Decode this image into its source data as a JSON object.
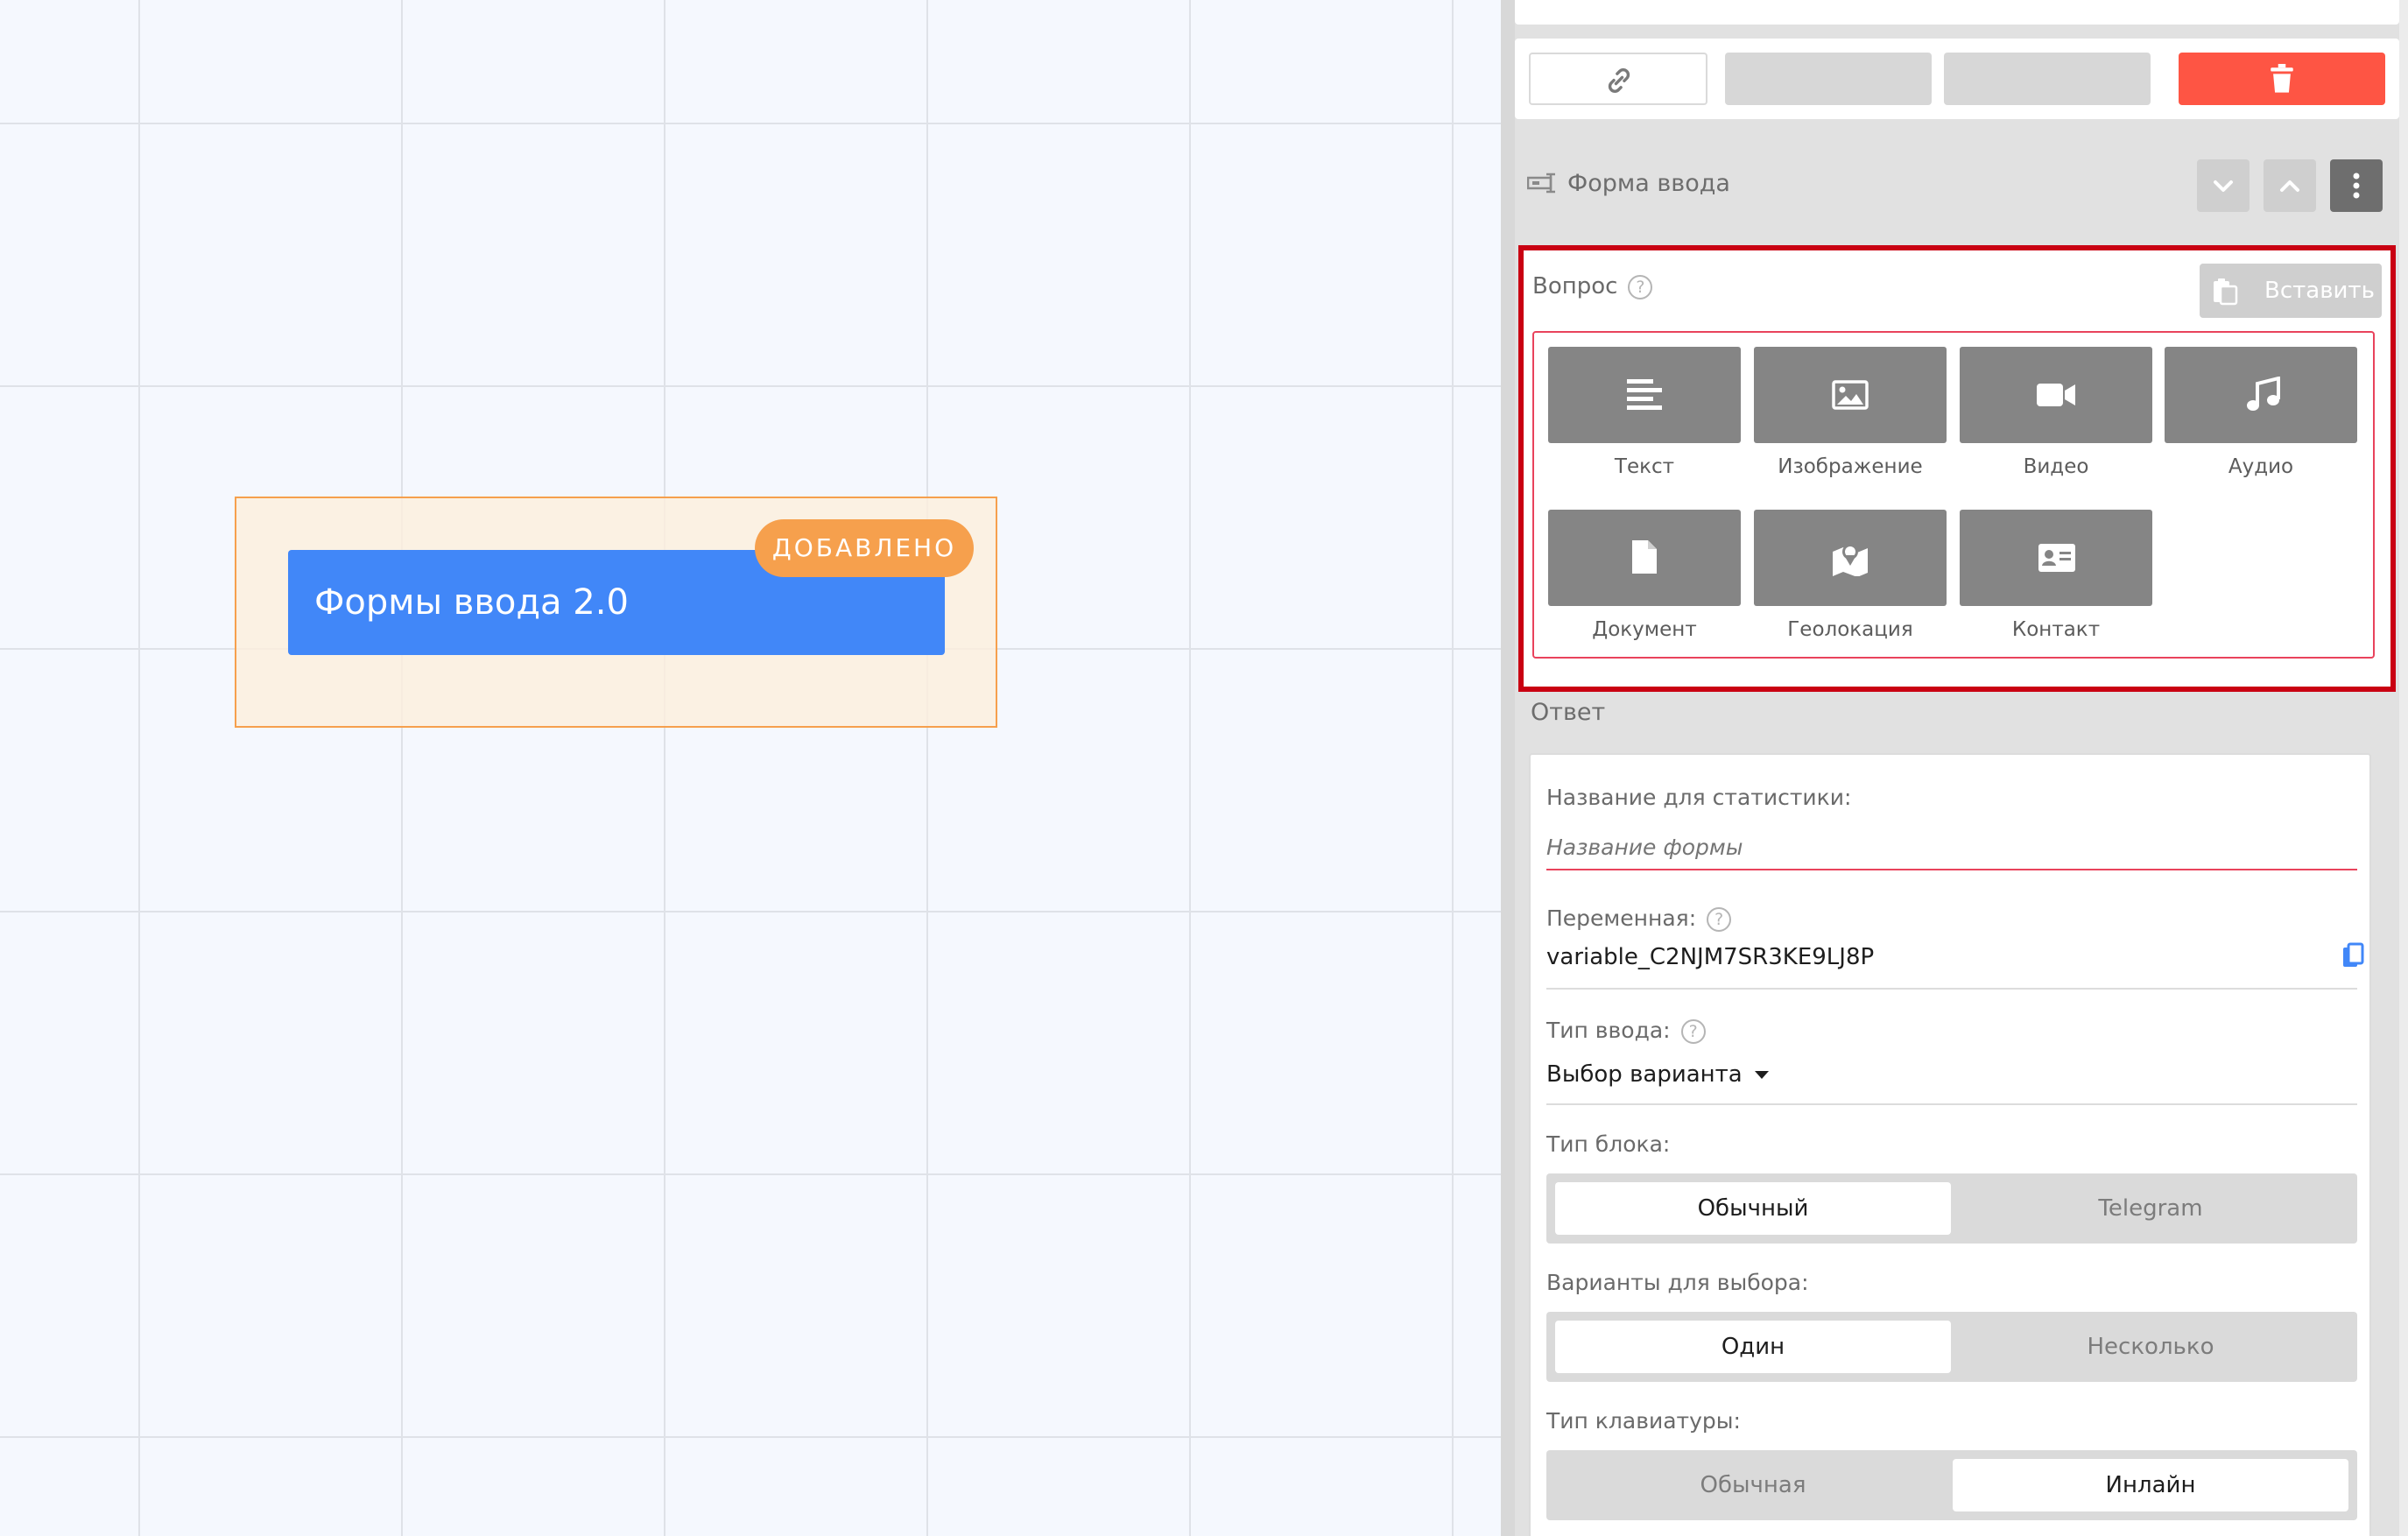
{
  "canvas": {
    "node_title": "Формы ввода 2.0",
    "node_badge": "ДОБАВЛЕНО"
  },
  "panel": {
    "block_type_title": "Форма ввода",
    "question": {
      "label": "Вопрос",
      "paste_label": "Вставить",
      "media": [
        "Текст",
        "Изображение",
        "Видео",
        "Аудио",
        "Документ",
        "Геолокация",
        "Контакт"
      ]
    },
    "answer": {
      "label": "Ответ",
      "stat_name_label": "Название для статистики:",
      "stat_name_placeholder": "Название формы",
      "variable_label": "Переменная:",
      "variable_value": "variable_C2NJM7SR3KE9LJ8P",
      "input_type_label": "Тип ввода:",
      "input_type_value": "Выбор варианта",
      "block_type_label": "Тип блока:",
      "block_type_options": [
        "Обычный",
        "Telegram"
      ],
      "choice_label": "Варианты для выбора:",
      "choice_options": [
        "Один",
        "Несколько"
      ],
      "keyboard_label": "Тип клавиатуры:",
      "keyboard_options": [
        "Обычная",
        "Инлайн"
      ]
    }
  },
  "colors": {
    "accent_blue": "#4187f8",
    "badge_orange": "#f6a04d",
    "delete_red": "#fe5544",
    "highlight_red": "#c90012"
  }
}
